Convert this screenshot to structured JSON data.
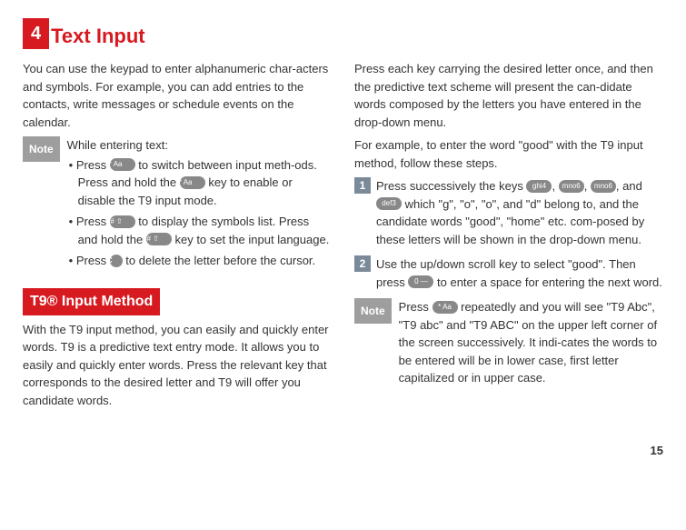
{
  "chapter": {
    "number": "4",
    "title": "Text Input"
  },
  "left": {
    "intro": "You can use the keypad to enter alphanumeric char-acters and symbols. For example, you can add entries to the contacts, write messages or schedule events on the calendar.",
    "note_label": "Note",
    "note_lead": "While entering text:",
    "bullet1a": "Press ",
    "bullet1b": " to switch between input meth-ods. Press and hold the ",
    "bullet1c": " key to enable or disable the T9 input mode.",
    "bullet2a": "Press ",
    "bullet2b": " to display the symbols list. Press and hold the ",
    "bullet2c": " key to set the input language.",
    "bullet3a": "Press ",
    "bullet3b": " to delete the letter before the cursor.",
    "section_heading": " T9® Input Method",
    "section_body": "With the T9 input method, you can easily and quickly enter words. T9 is a predictive text entry mode. It allows you to easily and quickly enter words. Press the relevant key that corresponds to the desired letter and T9 will offer you candidate words."
  },
  "right": {
    "para1": "Press each key carrying the desired letter once, and then the predictive text scheme will present the can-didate words composed by the letters you have entered in the drop-down menu.",
    "para2": "For example, to enter the word \"good\" with the T9 input method, follow these steps.",
    "step1_num": "1",
    "step1a": "Press successively the keys ",
    "step1b": ", ",
    "step1c": ", ",
    "step1d": ", and ",
    "step1e": " which \"g\", \"o\", \"o\", and \"d\" belong to, and the candidate words \"good\", \"home\" etc. com-posed by these letters will be shown in the drop-down menu.",
    "step2_num": "2",
    "step2a": "Use the up/down scroll key to select \"good\". Then press ",
    "step2b": " to enter a space for entering the next word.",
    "note_label": "Note",
    "note_a": "Press ",
    "note_b": " repeatedly and you will see \"T9 Abc\", \"T9 abc\" and \"T9 ABC\" on the upper left corner of the screen successively. It indi-cates the words to be entered will be in lower case, first letter capitalized or in upper case."
  },
  "keys": {
    "star": "* Aa",
    "hash": "# ⇧",
    "ghi4": "ghi4",
    "mno6": "mno6",
    "def3": "def3",
    "zero": "0 —"
  },
  "page_number": "15"
}
